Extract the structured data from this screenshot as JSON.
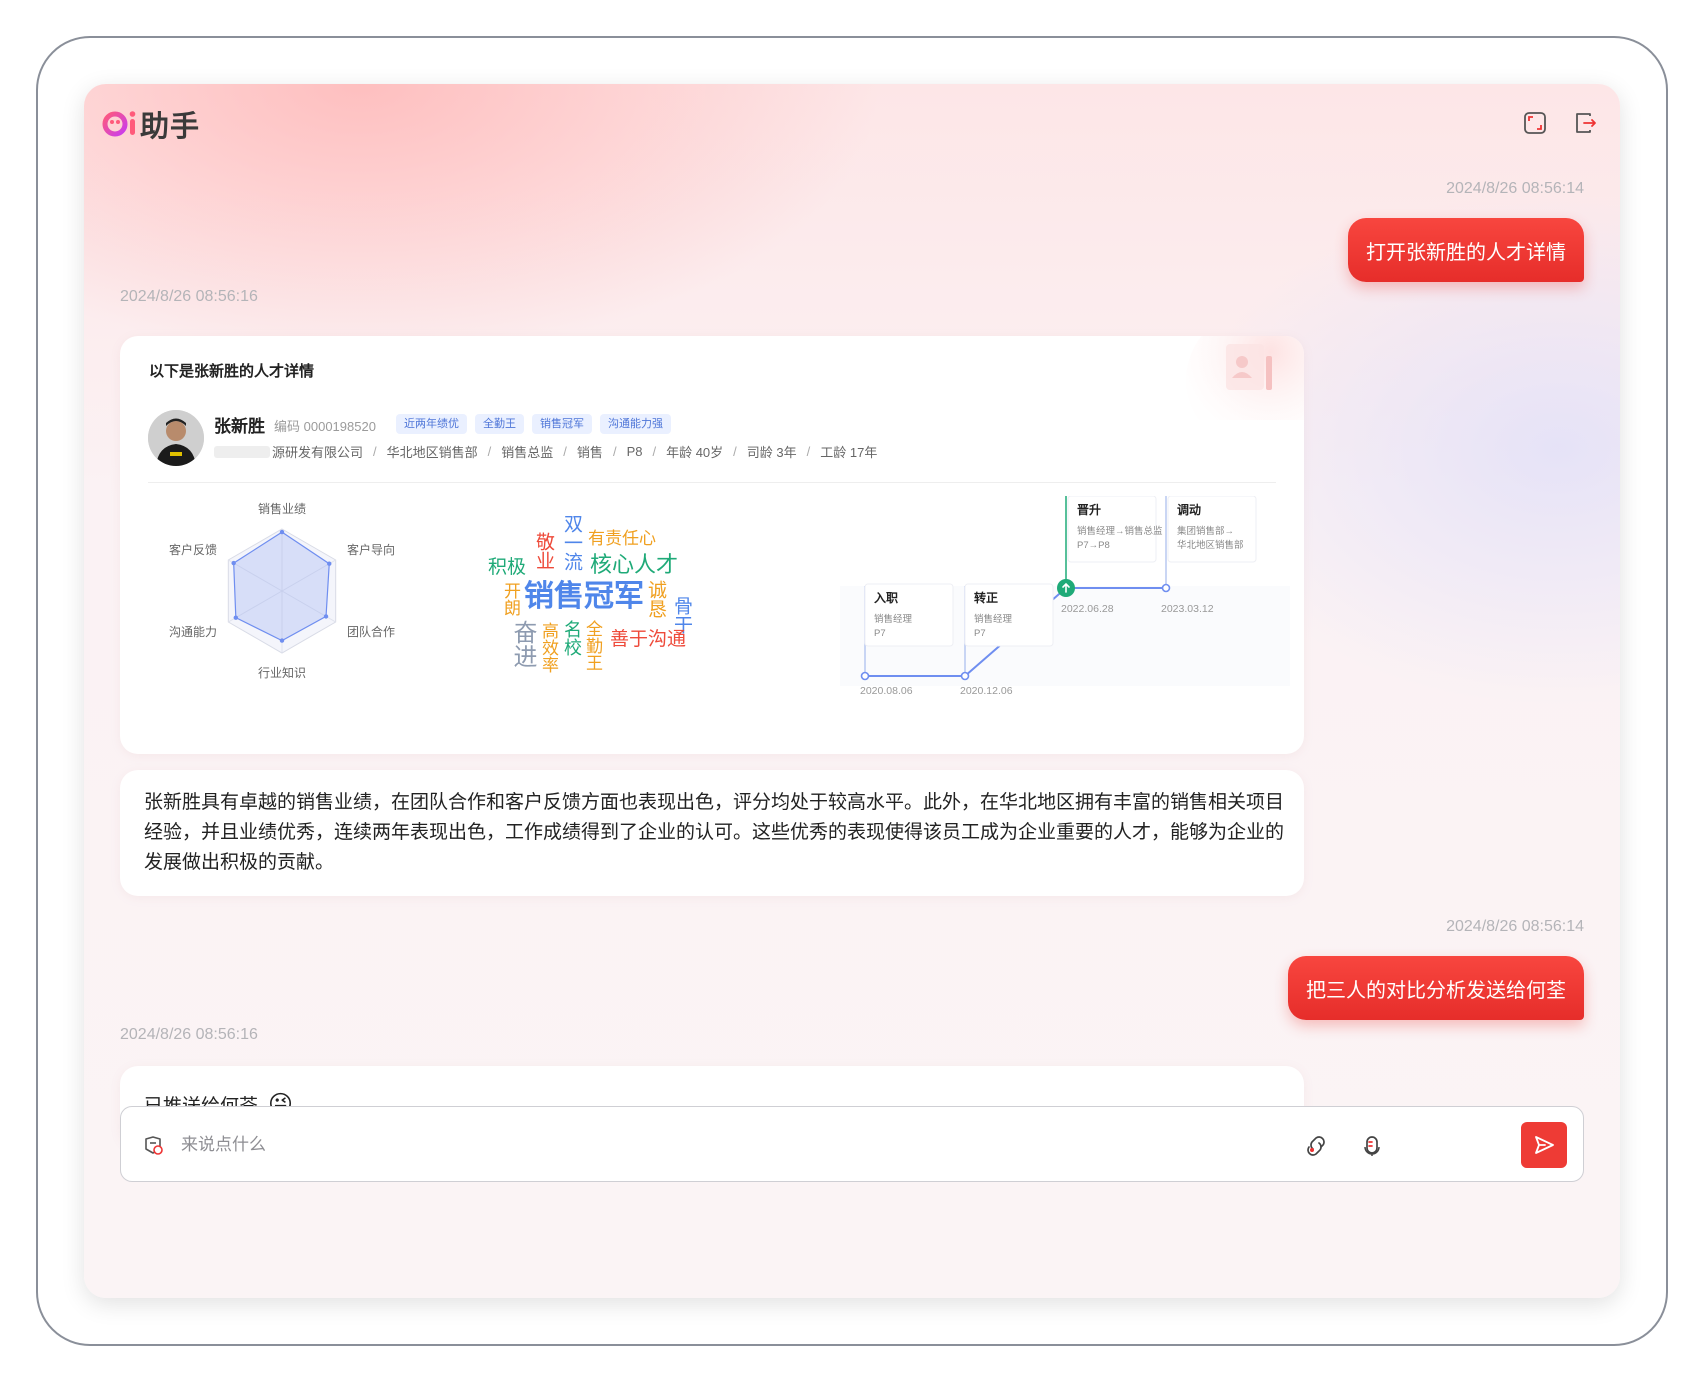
{
  "app": {
    "logo_text": "助手",
    "logo_mark": "Qi"
  },
  "header": {
    "icons": [
      "fullscreen-icon",
      "exit-icon"
    ]
  },
  "messages": [
    {
      "role": "user",
      "time": "2024/8/26 08:56:14",
      "text": "打开张新胜的人才详情"
    },
    {
      "role": "assistant",
      "time": "2024/8/26 08:56:16",
      "card_title": "以下是张新胜的人才详情"
    },
    {
      "role": "assistant",
      "text": "张新胜具有卓越的销售业绩，在团队合作和客户反馈方面也表现出色，评分均处于较高水平。此外，在华北地区拥有丰富的销售相关项目经验，并且业绩优秀，连续两年表现出色，工作成绩得到了企业的认可。这些优秀的表现使得该员工成为企业重要的人才，能够为企业的发展做出积极的贡献。"
    },
    {
      "role": "user",
      "time": "2024/8/26 08:56:14",
      "text": "把三人的对比分析发送给何荃"
    },
    {
      "role": "assistant",
      "time": "2024/8/26 08:56:16",
      "text": "已推送给何荃",
      "emoji": "😜"
    }
  ],
  "profile": {
    "name": "张新胜",
    "code_label": "编码",
    "code": "0000198520",
    "tags": [
      "近两年绩优",
      "全勤王",
      "销售冠军",
      "沟通能力强"
    ],
    "company": "源研发有限公司",
    "department": "华北地区销售部",
    "position": "销售总监",
    "sequence": "销售",
    "level": "P8",
    "age": "年龄 40岁",
    "company_years": "司龄 3年",
    "work_years": "工龄 17年"
  },
  "chart_data": [
    {
      "type": "radar",
      "axes": [
        "销售业绩",
        "客户导向",
        "团队合作",
        "行业知识",
        "沟通能力",
        "客户反馈"
      ],
      "values": [
        0.95,
        0.88,
        0.82,
        0.8,
        0.86,
        0.9
      ],
      "color": "#6f8ef0"
    },
    {
      "type": "wordcloud",
      "words": [
        {
          "text": "销售冠军",
          "color": "#4f86ea"
        },
        {
          "text": "核心人才",
          "color": "#1faa78"
        },
        {
          "text": "有责任心",
          "color": "#f0a020"
        },
        {
          "text": "积极",
          "color": "#1faa78"
        },
        {
          "text": "敬业",
          "color": "#ee4a3a"
        },
        {
          "text": "双一流",
          "color": "#4f86ea"
        },
        {
          "text": "诚恳",
          "color": "#f0a020"
        },
        {
          "text": "骨干",
          "color": "#4f86ea"
        },
        {
          "text": "开朗",
          "color": "#f0a020"
        },
        {
          "text": "奋进",
          "color": "#8e9bb0"
        },
        {
          "text": "高效率",
          "color": "#f0a020"
        },
        {
          "text": "名校",
          "color": "#1faa78"
        },
        {
          "text": "全勤王",
          "color": "#f0a020"
        },
        {
          "text": "善于沟通",
          "color": "#ee4a3a"
        }
      ]
    },
    {
      "type": "timeline",
      "events": [
        {
          "date": "2020.08.06",
          "title": "入职",
          "line1": "销售经理",
          "line2": "P7"
        },
        {
          "date": "2020.12.06",
          "title": "转正",
          "line1": "销售经理",
          "line2": "P7"
        },
        {
          "date": "2022.06.28",
          "title": "晋升",
          "line1": "销售经理→销售总监",
          "line2": "P7→P8"
        },
        {
          "date": "2023.03.12",
          "title": "调动",
          "line1": "集团销售部→",
          "line2": "华北地区销售部"
        }
      ]
    }
  ],
  "input": {
    "placeholder": "来说点什么",
    "value": ""
  },
  "colors": {
    "accent": "#ee3b35",
    "blue": "#4f86ea",
    "green": "#1faa78"
  }
}
